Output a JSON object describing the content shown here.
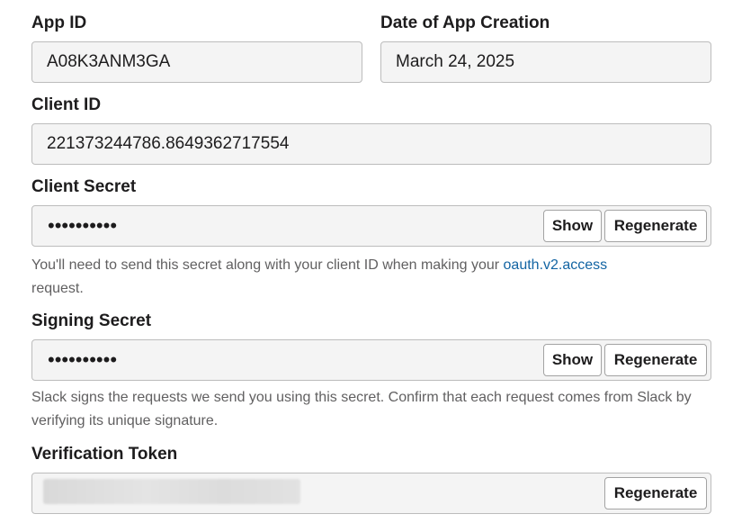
{
  "app_id": {
    "label": "App ID",
    "value": "A08K3ANM3GA"
  },
  "creation_date": {
    "label": "Date of App Creation",
    "value": "March 24, 2025"
  },
  "client_id": {
    "label": "Client ID",
    "value": "221373244786.8649362717554"
  },
  "client_secret": {
    "label": "Client Secret",
    "masked": "••••••••••",
    "show_label": "Show",
    "regenerate_label": "Regenerate",
    "help_before": "You'll need to send this secret along with your client ID when making your ",
    "help_link": "oauth.v2.access",
    "help_after": " request."
  },
  "signing_secret": {
    "label": "Signing Secret",
    "masked": "••••••••••",
    "show_label": "Show",
    "regenerate_label": "Regenerate",
    "help": "Slack signs the requests we send you using this secret. Confirm that each request comes from Slack by verifying its unique signature."
  },
  "verification_token": {
    "label": "Verification Token",
    "regenerate_label": "Regenerate"
  }
}
